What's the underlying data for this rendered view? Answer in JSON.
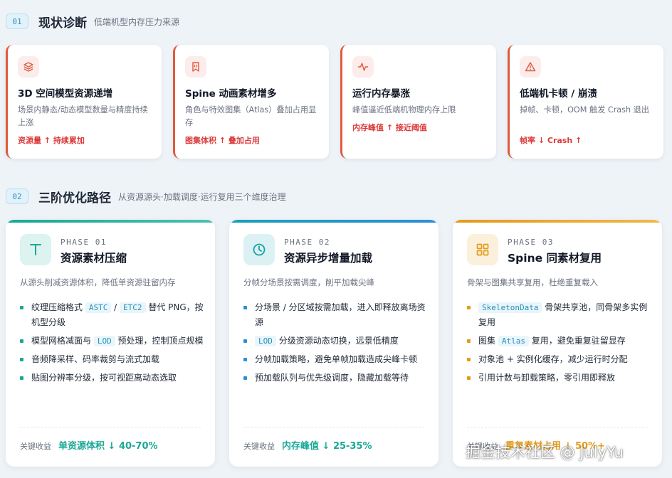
{
  "section1": {
    "number": "01",
    "title": "现状诊断",
    "subtitle": "低端机型内存压力来源",
    "cards": [
      {
        "icon": "layers-icon",
        "title": "3D 空间模型资源递增",
        "desc": "场景内静态/动态模型数量与精度持续上涨",
        "metric": "资源量 ↑ 持续累加"
      },
      {
        "icon": "bookmark-icon",
        "title": "Spine 动画素材增多",
        "desc": "角色与特效图集（Atlas）叠加占用显存",
        "metric": "图集体积 ↑ 叠加占用"
      },
      {
        "icon": "activity-icon",
        "title": "运行内存暴涨",
        "desc": "峰值逼近低端机物理内存上限",
        "metric": "内存峰值 ↑ 接近阈值"
      },
      {
        "icon": "warning-icon",
        "title": "低端机卡顿 / 崩溃",
        "desc": "掉帧、卡顿，OOM 触发 Crash 退出",
        "metric": "帧率 ↓ Crash ↑"
      }
    ]
  },
  "section2": {
    "number": "02",
    "title": "三阶优化路径",
    "subtitle": "从资源源头·加载调度·运行复用三个维度治理"
  },
  "colors": {
    "teal": "#19a896",
    "blue": "#2b8fd6",
    "orange": "#e49a1a",
    "red": "#e05a3c"
  },
  "phases": [
    {
      "icon": "text-t-icon",
      "label": "PHASE 01",
      "title": "资源素材压缩",
      "desc": "从源头削减资源体积，降低单资源驻留内存",
      "items": [
        {
          "pre": "纹理压缩格式 ",
          "code": "ASTC",
          "mid": " / ",
          "code2": "ETC2",
          "post": " 替代 PNG，按机型分级"
        },
        {
          "pre": "模型网格减面与 ",
          "code": "LOD",
          "post": " 预处理，控制顶点规模"
        },
        {
          "pre": "音频降采样、码率裁剪与流式加载"
        },
        {
          "pre": "贴图分辨率分级，按可视距离动态选取"
        }
      ],
      "gain_label": "关键收益",
      "gain_value": "单资源体积 ↓ 40-70%"
    },
    {
      "icon": "clock-icon",
      "label": "PHASE 02",
      "title": "资源异步增量加载",
      "desc": "分帧分场景按需调度，削平加载尖峰",
      "items": [
        {
          "pre": "分场景 / 分区域按需加载，进入即释放离场资源"
        },
        {
          "pre": "",
          "code": "LOD",
          "post": " 分级资源动态切换，远景低精度"
        },
        {
          "pre": "分帧加载策略，避免单帧加载造成尖峰卡顿"
        },
        {
          "pre": "预加载队列与优先级调度，隐藏加载等待"
        }
      ],
      "gain_label": "关键收益",
      "gain_value": "内存峰值 ↓ 25-35%"
    },
    {
      "icon": "grid-icon",
      "label": "PHASE 03",
      "title": "Spine 同素材复用",
      "desc": "骨架与图集共享复用，杜绝重复载入",
      "items": [
        {
          "pre": "",
          "code": "SkeletonData",
          "post": " 骨架共享池，同骨架多实例复用"
        },
        {
          "pre": "图集 ",
          "code": "Atlas",
          "post": " 复用，避免重复驻留显存"
        },
        {
          "pre": "对象池 + 实例化缓存，减少运行时分配"
        },
        {
          "pre": "引用计数与卸载策略，零引用即释放"
        }
      ],
      "gain_label": "关键收益",
      "gain_value": "重复素材占用 ↓ 50%+"
    }
  ],
  "watermark": "掘金技术社区 @ JulyYu"
}
